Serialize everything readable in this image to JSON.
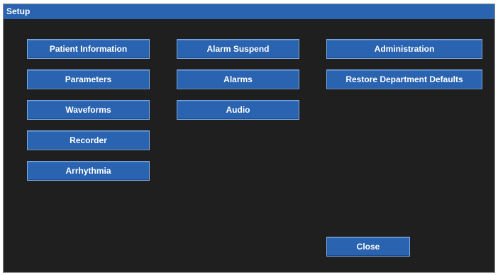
{
  "window": {
    "title": "Setup"
  },
  "buttons": {
    "patient_information": "Patient Information",
    "parameters": "Parameters",
    "waveforms": "Waveforms",
    "recorder": "Recorder",
    "arrhythmia": "Arrhythmia",
    "alarm_suspend": "Alarm Suspend",
    "alarms": "Alarms",
    "audio": "Audio",
    "administration": "Administration",
    "restore_department_defaults": "Restore Department Defaults",
    "close": "Close"
  },
  "colors": {
    "background": "#1f1f1f",
    "title_bar": "#2a63b0",
    "button": "#2a63b0",
    "button_text": "#ffffff"
  }
}
